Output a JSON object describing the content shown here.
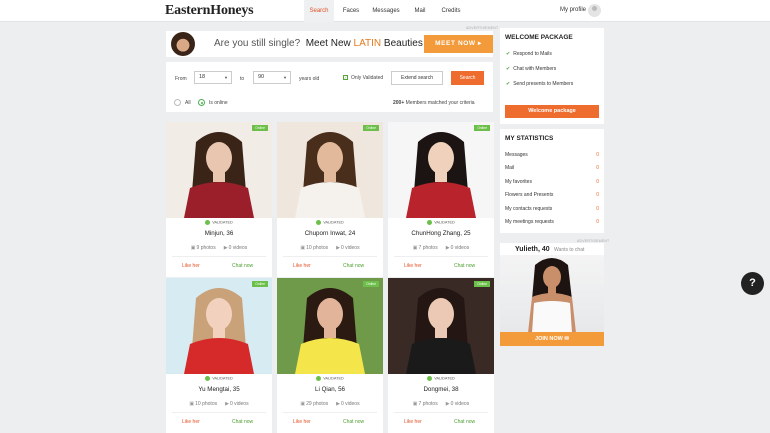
{
  "header": {
    "logo": "EasternHoneys",
    "nav": [
      "Search",
      "Faces",
      "Messages",
      "Mail",
      "Credits"
    ],
    "profile_label": "My profile"
  },
  "ad_label": "ADVERTISEMENT",
  "banner": {
    "text_q": "Are you still single?",
    "text_meet": "Meet New",
    "text_latin": "LATIN",
    "text_beauties": "Beauties",
    "button": "MEET NOW"
  },
  "filters": {
    "from_label": "From",
    "from_value": "18",
    "to_label": "to",
    "to_value": "90",
    "years_label": "years old",
    "only_validated": "Only Validated",
    "extend_search": "Extend search",
    "search_button": "Search",
    "radio_all": "All",
    "radio_online": "Is online",
    "match_count": "200+",
    "match_text": "Members matched your criteria"
  },
  "card_labels": {
    "online": "Online",
    "validated": "VALIDATED",
    "like": "Like her",
    "chat": "Chat now",
    "photos_suffix": "photos",
    "videos_suffix": "videos"
  },
  "cards": [
    {
      "name": "Minjun, 36",
      "photos": "9",
      "videos": "0"
    },
    {
      "name": "Chuporn Inwat, 24",
      "photos": "10",
      "videos": "0"
    },
    {
      "name": "ChunHong Zhang, 25",
      "photos": "7",
      "videos": "0"
    },
    {
      "name": "Yu Mengtai, 35",
      "photos": "10",
      "videos": "0"
    },
    {
      "name": "Li Qian, 56",
      "photos": "29",
      "videos": "0"
    },
    {
      "name": "Dongmei, 38",
      "photos": "7",
      "videos": "0"
    }
  ],
  "welcome": {
    "title": "WELCOME PACKAGE",
    "items": [
      "Respond to Mails",
      "Chat with Members",
      "Send presents to Members"
    ],
    "button": "Welcome package"
  },
  "stats": {
    "title": "MY STATISTICS",
    "items": [
      {
        "label": "Messages",
        "count": "0"
      },
      {
        "label": "Mail",
        "count": "0"
      },
      {
        "label": "My favorites",
        "count": "0"
      },
      {
        "label": "Flowers and Presents",
        "count": "0"
      },
      {
        "label": "My contacts requests",
        "count": "0"
      },
      {
        "label": "My meetings requests",
        "count": "0"
      }
    ]
  },
  "ad2": {
    "name": "Yulieth, 40",
    "subtitle": "Wants to chat",
    "button": "JOIN NOW"
  },
  "help_label": "?",
  "colors": {
    "accent": "#ef6c2f",
    "online": "#6cc04a",
    "chat": "#4c9f2f"
  }
}
